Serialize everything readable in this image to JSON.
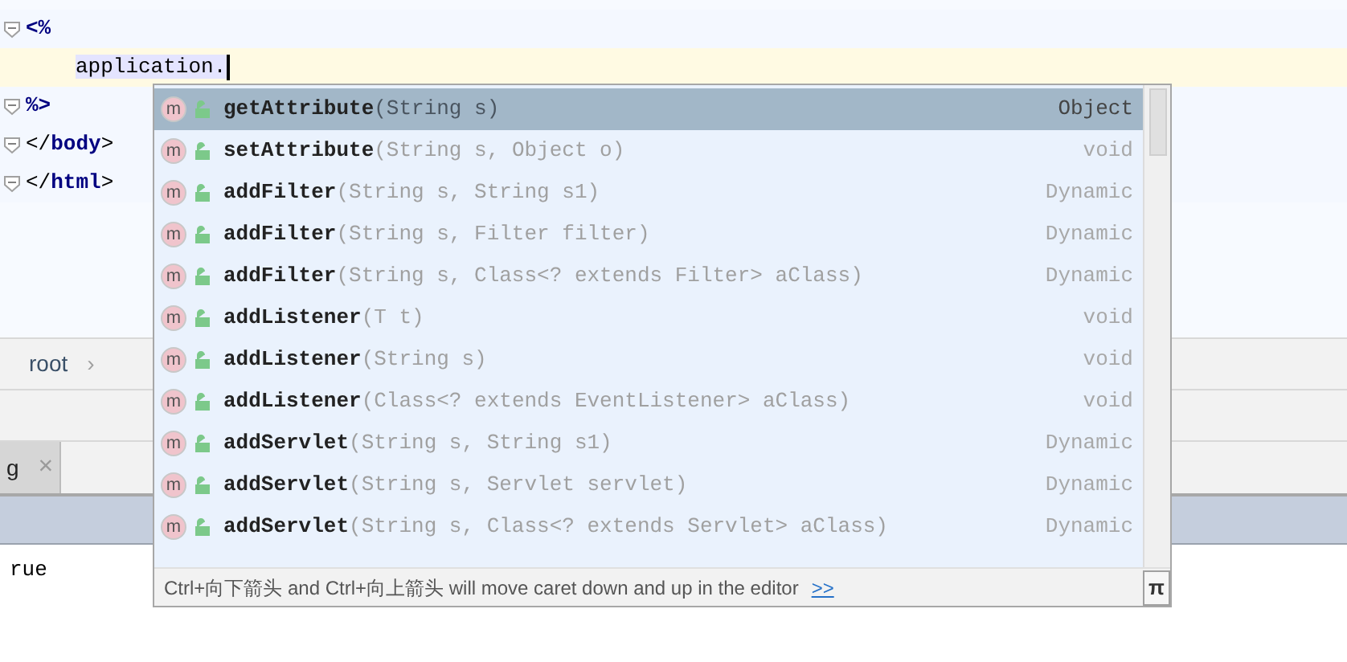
{
  "editor": {
    "lines": [
      {
        "current": false,
        "tokens": [
          {
            "text": "<%",
            "kind": "delim"
          }
        ]
      },
      {
        "current": true,
        "tokens": [
          {
            "text": "application.",
            "kind": "ident"
          }
        ]
      },
      {
        "current": false,
        "tokens": [
          {
            "text": "%>",
            "kind": "delim"
          }
        ]
      },
      {
        "current": false,
        "tokens": [
          {
            "text": "</",
            "kind": "plain"
          },
          {
            "text": "body",
            "kind": "delim"
          },
          {
            "text": ">",
            "kind": "plain"
          }
        ]
      },
      {
        "current": false,
        "tokens": [
          {
            "text": "</",
            "kind": "plain"
          },
          {
            "text": "html",
            "kind": "delim"
          },
          {
            "text": ">",
            "kind": "plain"
          }
        ]
      }
    ]
  },
  "breadcrumb": {
    "items": [
      "root"
    ],
    "separator": "›"
  },
  "tool_tabs": [
    {
      "label": "g",
      "close": "×"
    }
  ],
  "console": {
    "lines": [
      "rue"
    ]
  },
  "completion": {
    "items": [
      {
        "icon": "m",
        "name": "getAttribute",
        "params": "(String s)",
        "type": "Object",
        "selected": true
      },
      {
        "icon": "m",
        "name": "setAttribute",
        "params": "(String s, Object o)",
        "type": "void",
        "selected": false
      },
      {
        "icon": "m",
        "name": "addFilter",
        "params": "(String s, String s1)",
        "type": "Dynamic",
        "selected": false
      },
      {
        "icon": "m",
        "name": "addFilter",
        "params": "(String s, Filter filter)",
        "type": "Dynamic",
        "selected": false
      },
      {
        "icon": "m",
        "name": "addFilter",
        "params": "(String s, Class<? extends Filter> aClass)",
        "type": "Dynamic",
        "selected": false
      },
      {
        "icon": "m",
        "name": "addListener",
        "params": "(T t)",
        "type": "void",
        "selected": false
      },
      {
        "icon": "m",
        "name": "addListener",
        "params": "(String s)",
        "type": "void",
        "selected": false
      },
      {
        "icon": "m",
        "name": "addListener",
        "params": "(Class<? extends EventListener> aClass)",
        "type": "void",
        "selected": false
      },
      {
        "icon": "m",
        "name": "addServlet",
        "params": "(String s, String s1)",
        "type": "Dynamic",
        "selected": false
      },
      {
        "icon": "m",
        "name": "addServlet",
        "params": "(String s, Servlet servlet)",
        "type": "Dynamic",
        "selected": false
      },
      {
        "icon": "m",
        "name": "addServlet",
        "params": "(String s, Class<? extends Servlet> aClass)",
        "type": "Dynamic",
        "selected": false
      }
    ],
    "hint": "Ctrl+向下箭头 and Ctrl+向上箭头 will move caret down and up in the editor",
    "hint_link": ">>",
    "pi_button": "π"
  }
}
